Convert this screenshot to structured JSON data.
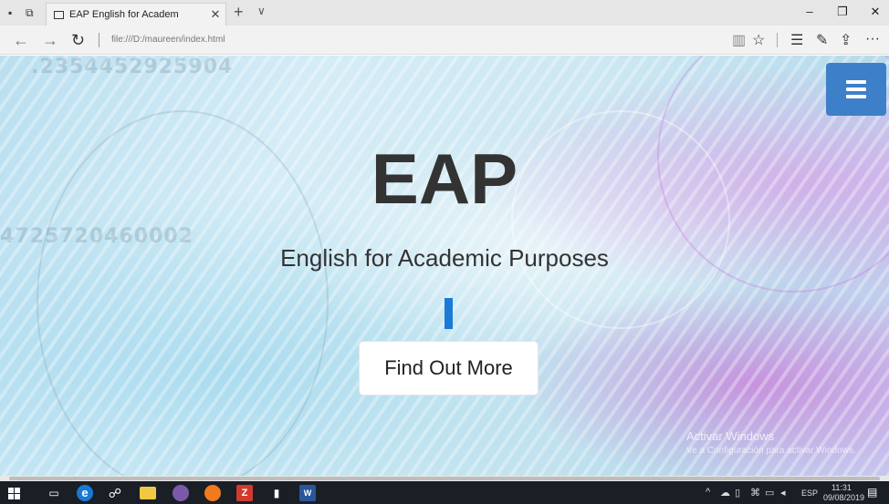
{
  "browser": {
    "tab_title": "EAP English for Academ",
    "tab_close": "✕",
    "new_tab": "+",
    "tab_menu": "∨",
    "url": "file:///D:/maureen/index.html",
    "window_controls": {
      "minimize": "–",
      "restore": "❐",
      "close": "✕"
    },
    "nav": {
      "back": "←",
      "forward": "→",
      "refresh": "↻"
    },
    "tools": {
      "reading_view": "▥",
      "favorite": "☆",
      "hub": "☰",
      "notes": "✎",
      "share": "⇪",
      "more": "···"
    }
  },
  "page": {
    "title": "EAP",
    "subtitle": "English for Academic Purposes",
    "cta_label": "Find Out More",
    "watermark_title": "Activar Windows",
    "watermark_sub": "Ve a Configuración para activar Windows."
  },
  "taskbar": {
    "language": "ESP",
    "time": "11:31",
    "date": "09/08/2019",
    "edge_glyph": "e",
    "word_glyph": "W",
    "zip_glyph": "Z"
  },
  "colors": {
    "accent_blue": "#1b7ad6",
    "menu_button": "#3d7fc8",
    "heading_text": "#333333"
  }
}
